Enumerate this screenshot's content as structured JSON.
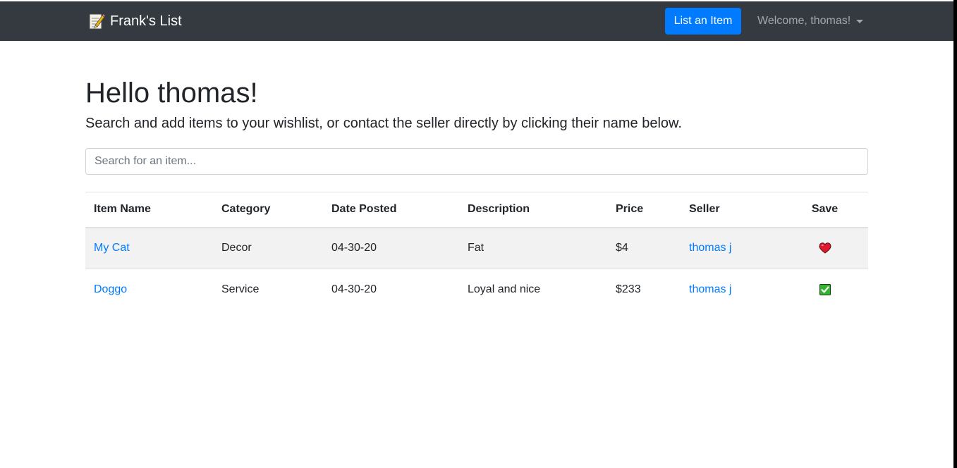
{
  "navbar": {
    "brand_icon": "memo-icon",
    "brand": "Frank's List",
    "list_button": "List an Item",
    "welcome": "Welcome, thomas!"
  },
  "main": {
    "title": "Hello thomas!",
    "lead": "Search and add items to your wishlist, or contact the seller directly by clicking their name below."
  },
  "search": {
    "placeholder": "Search for an item...",
    "value": ""
  },
  "table": {
    "columns": [
      "Item Name",
      "Category",
      "Date Posted",
      "Description",
      "Price",
      "Seller",
      "Save"
    ],
    "rows": [
      {
        "name": "My Cat",
        "category": "Decor",
        "date": "04-30-20",
        "description": "Fat",
        "price": "$4",
        "seller": "thomas j",
        "save_icon": "heart-icon"
      },
      {
        "name": "Doggo",
        "category": "Service",
        "date": "04-30-20",
        "description": "Loyal and nice",
        "price": "$233",
        "seller": "thomas j",
        "save_icon": "check-icon"
      }
    ]
  },
  "colors": {
    "navbar_bg": "#343a40",
    "primary": "#007bff",
    "heart": "#e0182d",
    "check_bg": "#31b531"
  }
}
